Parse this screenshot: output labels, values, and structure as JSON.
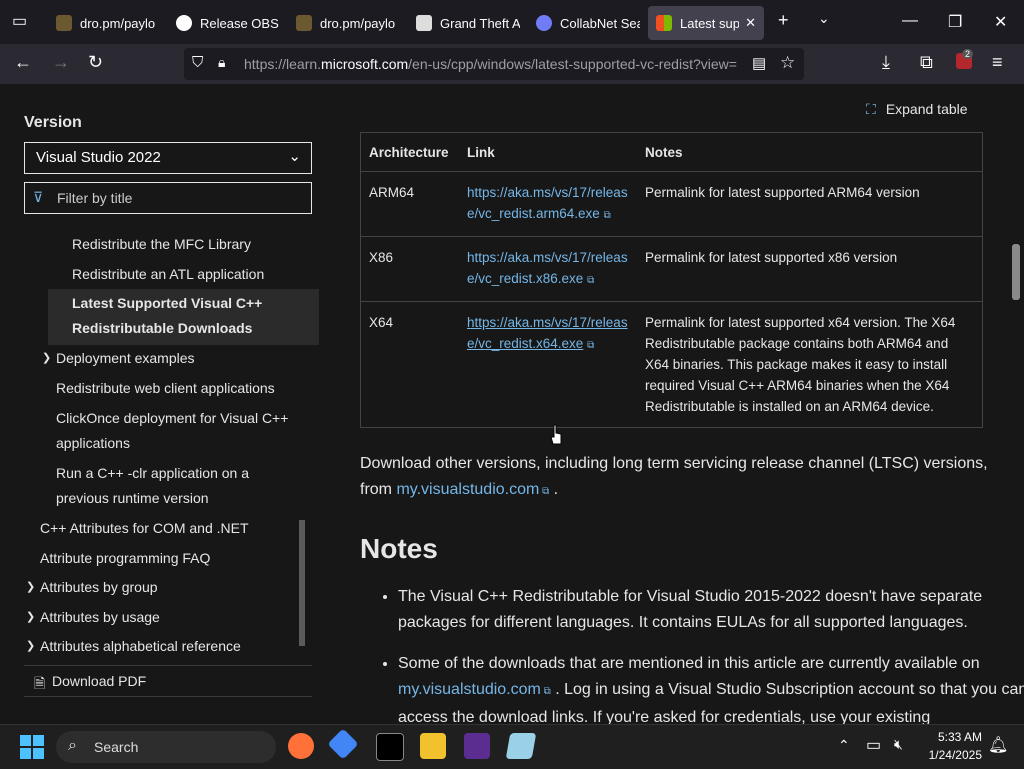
{
  "browser": {
    "tabs": [
      {
        "label": "dro.pm/paylo",
        "color": "#6b5a2f"
      },
      {
        "label": "Release OBS St",
        "color": "#ffffff"
      },
      {
        "label": "dro.pm/paylo",
        "color": "#6b5a2f"
      },
      {
        "label": "Grand Theft A",
        "color": "#dddddd"
      },
      {
        "label": "CollabNet Sear",
        "color": "#6f7cf5"
      },
      {
        "label": "Latest suppo",
        "color": "#f25022"
      }
    ],
    "url_prefix": "https://learn.",
    "url_domain": "microsoft.com",
    "url_rest": "/en-us/cpp/windows/latest-supported-vc-redist?view=",
    "extension_badge": "2"
  },
  "sidebar": {
    "version_title": "Version",
    "version_value": "Visual Studio 2022",
    "filter_placeholder": "Filter by title",
    "items": [
      {
        "label": "Redistribute the MFC Library"
      },
      {
        "label": "Redistribute an ATL application"
      },
      {
        "label": "Latest Supported Visual C++ Redistributable Downloads"
      },
      {
        "label": "Deployment examples"
      },
      {
        "label": "Redistribute web client applications"
      },
      {
        "label": "ClickOnce deployment for Visual C++ applications"
      },
      {
        "label": "Run a C++ -clr application on a previous runtime version"
      },
      {
        "label": "C++ Attributes for COM and .NET"
      },
      {
        "label": "Attribute programming FAQ"
      },
      {
        "label": "Attributes by group"
      },
      {
        "label": "Attributes by usage"
      },
      {
        "label": "Attributes alphabetical reference"
      }
    ],
    "download_pdf": "Download PDF"
  },
  "main": {
    "expand_table": "Expand table",
    "table": {
      "headers": [
        "Architecture",
        "Link",
        "Notes"
      ],
      "rows": [
        {
          "arch": "ARM64",
          "link": "https://aka.ms/vs/17/release/vc_redist.arm64.exe",
          "notes": "Permalink for latest supported ARM64 version"
        },
        {
          "arch": "X86",
          "link": "https://aka.ms/vs/17/release/vc_redist.x86.exe",
          "notes": "Permalink for latest supported x86 version"
        },
        {
          "arch": "X64",
          "link": "https://aka.ms/vs/17/release/vc_redist.x64.exe",
          "notes": "Permalink for latest supported x64 version. The X64 Redistributable package contains both ARM64 and X64 binaries. This package makes it easy to install required Visual C++ ARM64 binaries when the X64 Redistributable is installed on an ARM64 device."
        }
      ]
    },
    "other_versions_text": "Download other versions, including long term servicing release channel (LTSC) versions, from",
    "other_versions_link": "my.visualstudio.com",
    "notes_heading": "Notes",
    "note1": "The Visual C++ Redistributable for Visual Studio 2015-2022 doesn't have separate packages for different languages. It contains EULAs for all supported languages.",
    "note2_pre": "Some of the downloads that are mentioned in this article are currently available on",
    "note2_link": "my.visualstudio.com",
    "note2_post": ". Log in using a Visual Studio Subscription account so that you can access the download links. If you're asked for credentials, use your existing"
  },
  "taskbar": {
    "search_label": "Search",
    "time": "5:33 AM",
    "date": "1/24/2025"
  }
}
